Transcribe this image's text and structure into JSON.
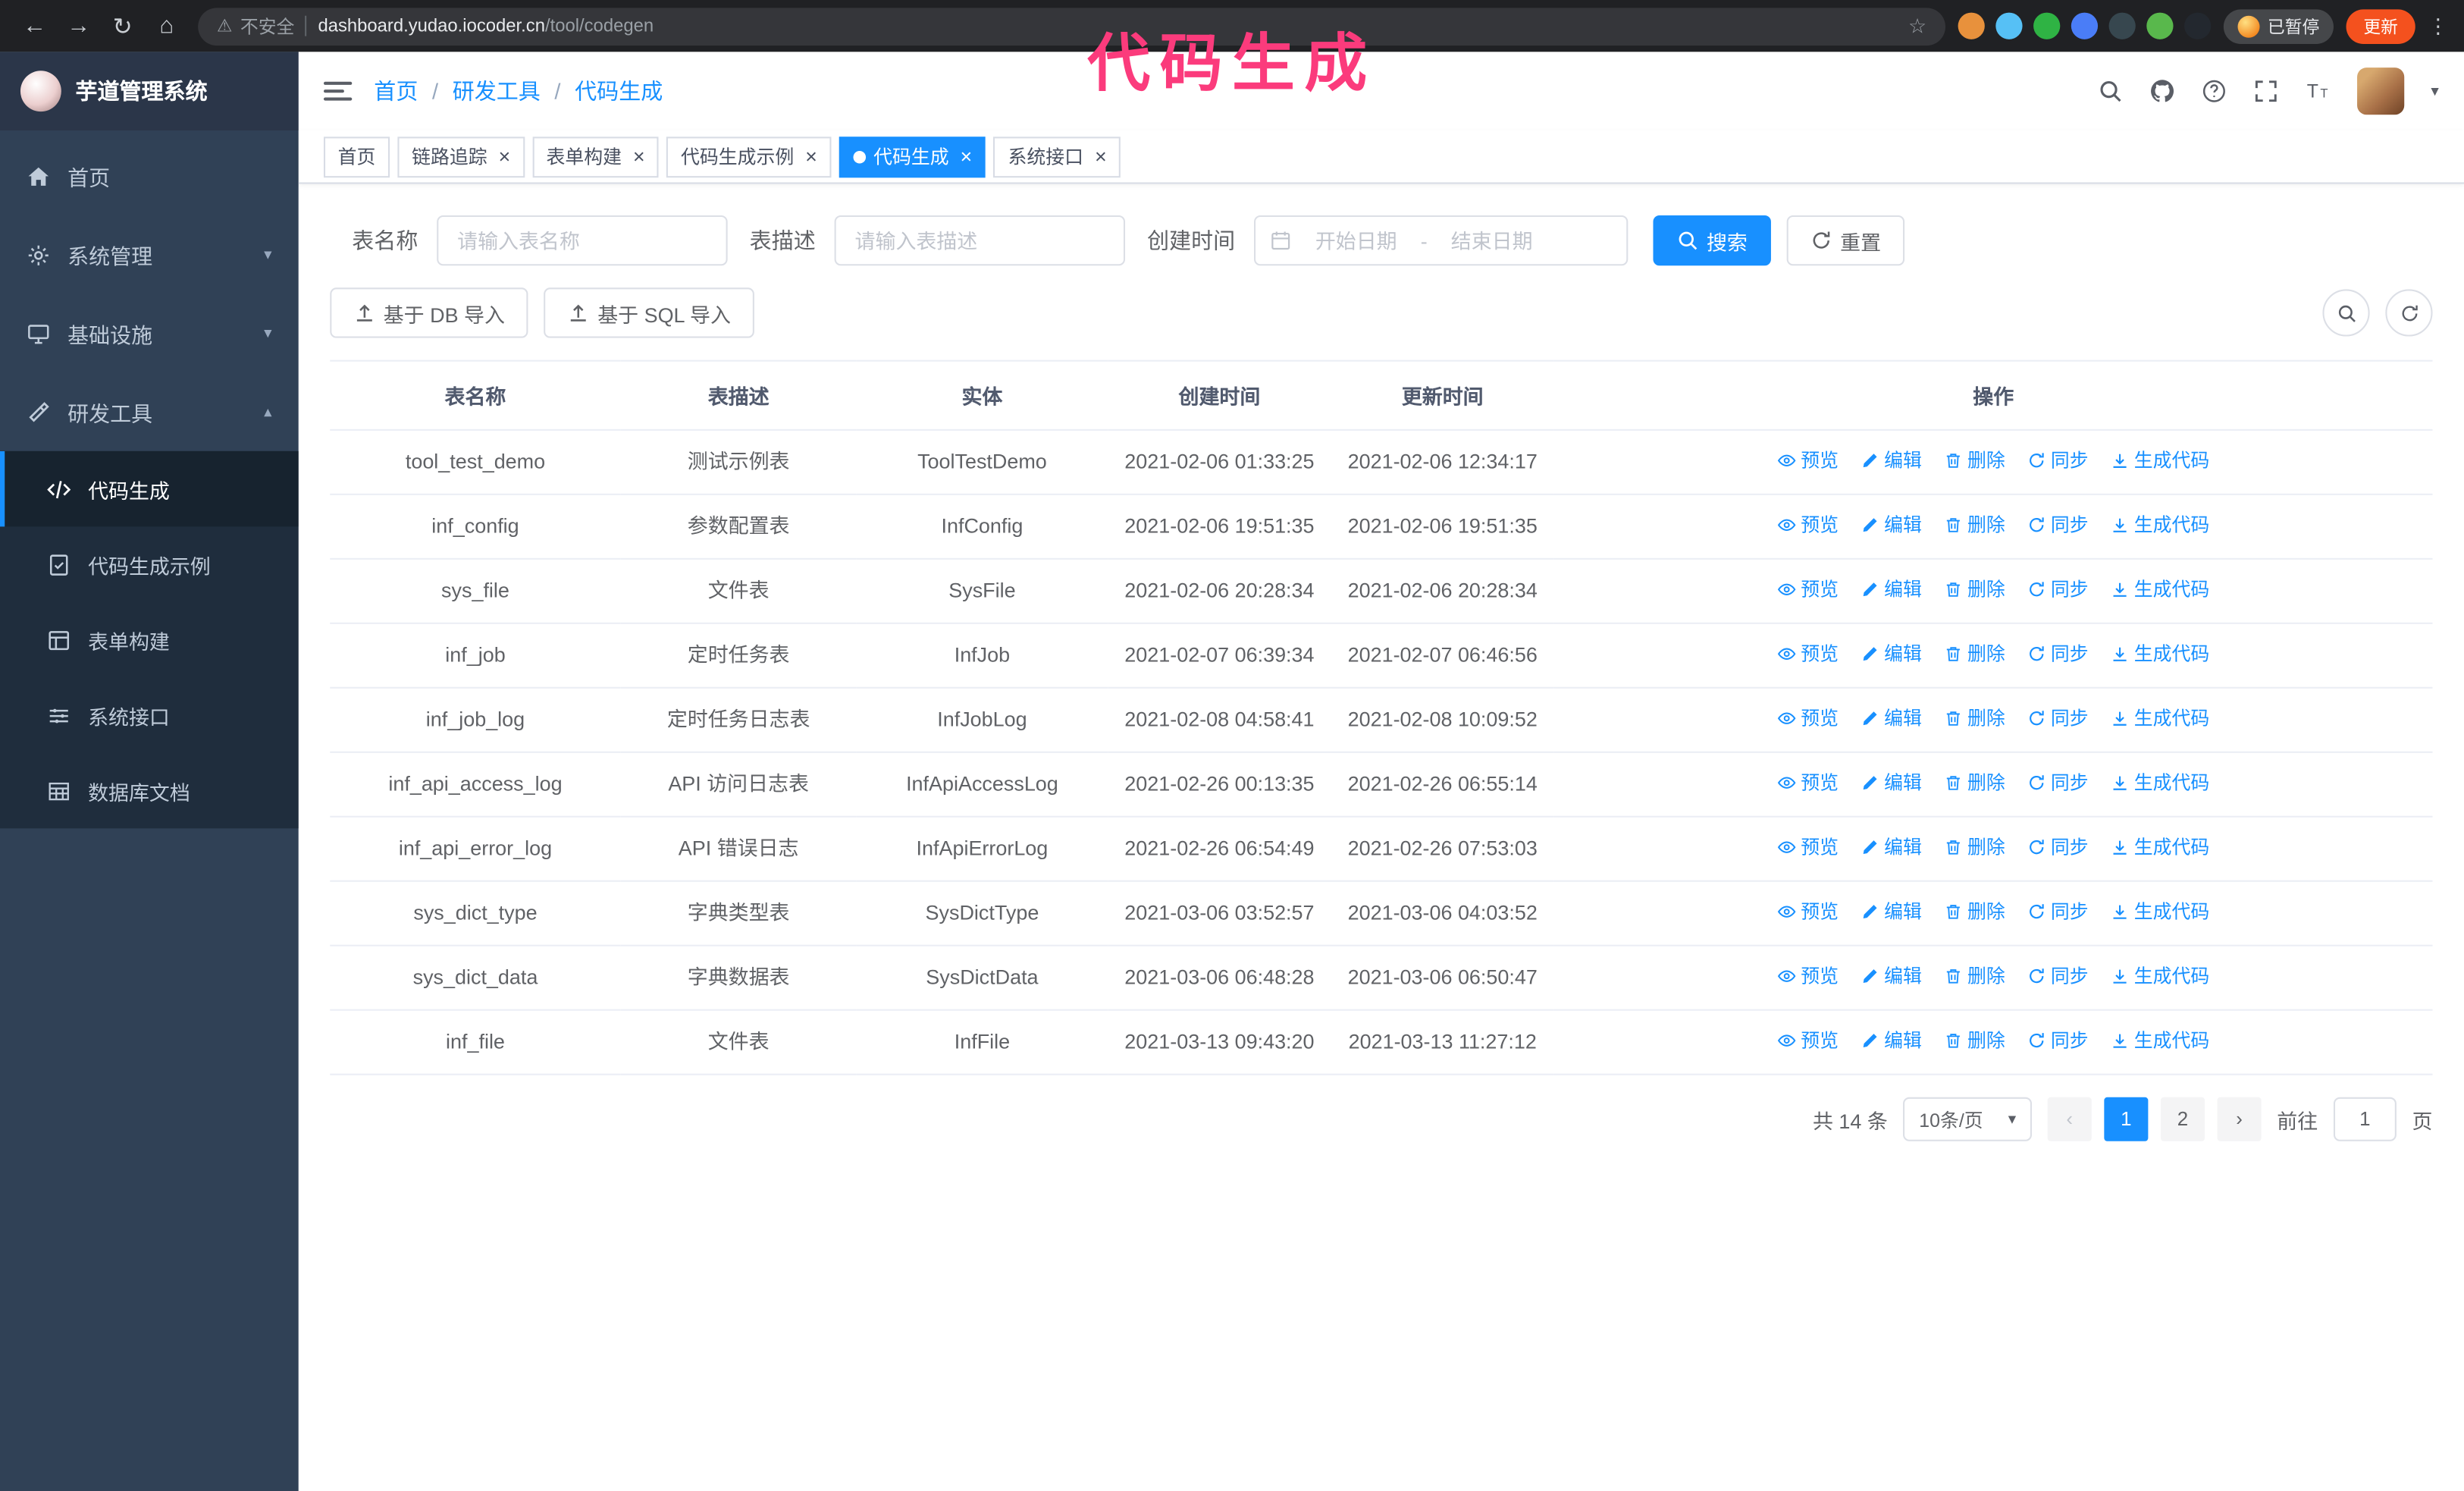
{
  "colors": {
    "accent": "#1890ff",
    "sidebar_bg": "#304156",
    "sidebar_submenu_bg": "#1f2d3d",
    "annotation_pink": "#fb3b7c",
    "update_button": "#f4511e"
  },
  "annotation_text": "代码生成",
  "browser": {
    "nav_icons": [
      "back-icon",
      "forward-icon",
      "reload-icon",
      "browser-home-icon"
    ],
    "security_warning": "不安全",
    "url_domain": "dashboard.yudao.iocoder.cn",
    "url_path": "/tool/codegen",
    "paused_chip": "已暂停",
    "update_button": "更新"
  },
  "sidebar": {
    "logo_title": "芋道管理系统",
    "menu": [
      {
        "label": "首页",
        "icon": "home-icon",
        "expandable": false,
        "expanded": false
      },
      {
        "label": "系统管理",
        "icon": "gear-icon",
        "expandable": true,
        "expanded": false
      },
      {
        "label": "基础设施",
        "icon": "infrastructure-icon",
        "expandable": true,
        "expanded": false
      },
      {
        "label": "研发工具",
        "icon": "tools-icon",
        "expandable": true,
        "expanded": true
      }
    ],
    "submenu": [
      {
        "label": "代码生成",
        "icon": "code-icon",
        "active": true
      },
      {
        "label": "代码生成示例",
        "icon": "example-icon",
        "active": false
      },
      {
        "label": "表单构建",
        "icon": "form-icon",
        "active": false
      },
      {
        "label": "系统接口",
        "icon": "api-icon",
        "active": false
      },
      {
        "label": "数据库文档",
        "icon": "database-doc-icon",
        "active": false
      }
    ]
  },
  "navbar": {
    "breadcrumb": [
      "首页",
      "研发工具",
      "代码生成"
    ]
  },
  "tabs": [
    {
      "label": "首页",
      "closable": false,
      "active": false
    },
    {
      "label": "链路追踪",
      "closable": true,
      "active": false
    },
    {
      "label": "表单构建",
      "closable": true,
      "active": false
    },
    {
      "label": "代码生成示例",
      "closable": true,
      "active": false
    },
    {
      "label": "代码生成",
      "closable": true,
      "active": true
    },
    {
      "label": "系统接口",
      "closable": true,
      "active": false
    }
  ],
  "filters": {
    "table_name_label": "表名称",
    "table_name_placeholder": "请输入表名称",
    "table_desc_label": "表描述",
    "table_desc_placeholder": "请输入表描述",
    "create_time_label": "创建时间",
    "date_start_placeholder": "开始日期",
    "date_range_separator": "-",
    "date_end_placeholder": "结束日期",
    "search_button": "搜索",
    "reset_button": "重置"
  },
  "toolbar": {
    "import_db_button": "基于 DB 导入",
    "import_sql_button": "基于 SQL 导入"
  },
  "table": {
    "columns": [
      "表名称",
      "表描述",
      "实体",
      "创建时间",
      "更新时间",
      "操作"
    ],
    "actions": [
      {
        "label": "预览",
        "icon": "eye-icon"
      },
      {
        "label": "编辑",
        "icon": "edit-icon"
      },
      {
        "label": "删除",
        "icon": "delete-icon"
      },
      {
        "label": "同步",
        "icon": "sync-icon"
      },
      {
        "label": "生成代码",
        "icon": "download-icon"
      }
    ],
    "rows": [
      {
        "name": "tool_test_demo",
        "desc": "测试示例表",
        "entity": "ToolTestDemo",
        "created": "2021-02-06 01:33:25",
        "updated": "2021-02-06 12:34:17"
      },
      {
        "name": "inf_config",
        "desc": "参数配置表",
        "entity": "InfConfig",
        "created": "2021-02-06 19:51:35",
        "updated": "2021-02-06 19:51:35"
      },
      {
        "name": "sys_file",
        "desc": "文件表",
        "entity": "SysFile",
        "created": "2021-02-06 20:28:34",
        "updated": "2021-02-06 20:28:34"
      },
      {
        "name": "inf_job",
        "desc": "定时任务表",
        "entity": "InfJob",
        "created": "2021-02-07 06:39:34",
        "updated": "2021-02-07 06:46:56"
      },
      {
        "name": "inf_job_log",
        "desc": "定时任务日志表",
        "entity": "InfJobLog",
        "created": "2021-02-08 04:58:41",
        "updated": "2021-02-08 10:09:52"
      },
      {
        "name": "inf_api_access_log",
        "desc": "API 访问日志表",
        "entity": "InfApiAccessLog",
        "created": "2021-02-26 00:13:35",
        "updated": "2021-02-26 06:55:14"
      },
      {
        "name": "inf_api_error_log",
        "desc": "API 错误日志",
        "entity": "InfApiErrorLog",
        "created": "2021-02-26 06:54:49",
        "updated": "2021-02-26 07:53:03"
      },
      {
        "name": "sys_dict_type",
        "desc": "字典类型表",
        "entity": "SysDictType",
        "created": "2021-03-06 03:52:57",
        "updated": "2021-03-06 04:03:52"
      },
      {
        "name": "sys_dict_data",
        "desc": "字典数据表",
        "entity": "SysDictData",
        "created": "2021-03-06 06:48:28",
        "updated": "2021-03-06 06:50:47"
      },
      {
        "name": "inf_file",
        "desc": "文件表",
        "entity": "InfFile",
        "created": "2021-03-13 09:43:20",
        "updated": "2021-03-13 11:27:12"
      }
    ]
  },
  "pagination": {
    "total_text": "共 14 条",
    "page_size_text": "10条/页",
    "pages": [
      "1",
      "2"
    ],
    "active_page": "1",
    "goto_label": "前往",
    "goto_value": "1",
    "goto_unit": "页"
  },
  "icons": {
    "back-icon": "←",
    "forward-icon": "→",
    "reload-icon": "↻",
    "browser-home-icon": "⌂",
    "warning-icon": "⚠",
    "star-icon": "☆",
    "kebab-menu-icon": "⋮",
    "caret-down-icon": "▾",
    "chevron-down-icon": "▾",
    "chevron-up-icon": "▴",
    "prev-page-icon": "‹",
    "next-page-icon": "›",
    "search-icon": "svg",
    "github-icon": "svg",
    "help-icon": "svg",
    "fullscreen-icon": "svg",
    "font-size-icon": "svg",
    "calendar-icon": "svg",
    "refresh-icon": "svg",
    "upload-icon": "svg",
    "home-icon": "svg",
    "gear-icon": "svg",
    "infrastructure-icon": "svg",
    "tools-icon": "svg",
    "code-icon": "svg",
    "example-icon": "svg",
    "form-icon": "svg",
    "api-icon": "svg",
    "database-doc-icon": "svg",
    "eye-icon": "svg",
    "edit-icon": "svg",
    "delete-icon": "svg",
    "sync-icon": "svg",
    "download-icon": "svg"
  }
}
